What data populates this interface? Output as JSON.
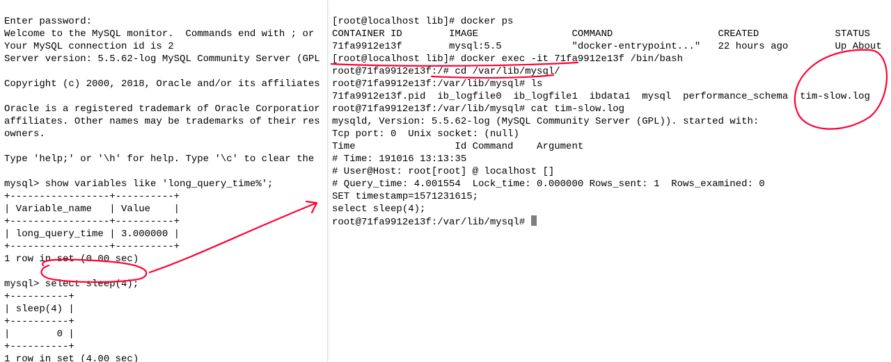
{
  "left": {
    "lines": [
      "Enter password:",
      "Welcome to the MySQL monitor.  Commands end with ; or ",
      "Your MySQL connection id is 2",
      "Server version: 5.5.62-log MySQL Community Server (GPL",
      "",
      "Copyright (c) 2000, 2018, Oracle and/or its affiliates",
      "",
      "Oracle is a registered trademark of Oracle Corporatior",
      "affiliates. Other names may be trademarks of their res",
      "owners.",
      "",
      "Type 'help;' or '\\h' for help. Type '\\c' to clear the ",
      "",
      "mysql> show variables like 'long_query_time%';",
      "+-----------------+----------+",
      "| Variable_name   | Value    |",
      "+-----------------+----------+",
      "| long_query_time | 3.000000 |",
      "+-----------------+----------+",
      "1 row in set (0.00 sec)",
      "",
      "mysql> select sleep(4);",
      "+----------+",
      "| sleep(4) |",
      "+----------+",
      "|        0 |",
      "+----------+",
      "1 row in set (4.00 sec)"
    ]
  },
  "right": {
    "docker_ps_cmd": "[root@localhost lib]# docker ps",
    "docker_ps_header": "CONTAINER ID        IMAGE                COMMAND                  CREATED             STATUS",
    "docker_ps_row": "71fa9912e13f        mysql:5.5            \"docker-entrypoint...\"   22 hours ago        Up About",
    "exec_cmd": "[root@localhost lib]# docker exec -it 71fa9912e13f /bin/bash",
    "cd_cmd": "root@71fa9912e13f:/# cd /var/lib/mysql/",
    "ls_cmd": "root@71fa9912e13f:/var/lib/mysql# ls",
    "ls_out": "71fa9912e13f.pid  ib_logfile0  ib_logfile1  ibdata1  mysql  performance_schema  tim-slow.log",
    "cat_cmd": "root@71fa9912e13f:/var/lib/mysql# cat tim-slow.log",
    "log1": "mysqld, Version: 5.5.62-log (MySQL Community Server (GPL)). started with:",
    "log2": "Tcp port: 0  Unix socket: (null)",
    "log3": "Time                 Id Command    Argument",
    "log4": "# Time: 191016 13:13:35",
    "log5": "# User@Host: root[root] @ localhost []",
    "log6": "# Query_time: 4.001554  Lock_time: 0.000000 Rows_sent: 1  Rows_examined: 0",
    "log7": "SET timestamp=1571231615;",
    "log8": "select sleep(4);",
    "prompt2": "root@71fa9912e13f:/var/lib/mysql# "
  },
  "chart_data": {
    "type": "table",
    "tables": [
      {
        "title": "show variables like 'long_query_time%'",
        "columns": [
          "Variable_name",
          "Value"
        ],
        "rows": [
          [
            "long_query_time",
            "3.000000"
          ]
        ],
        "footer": "1 row in set (0.00 sec)"
      },
      {
        "title": "select sleep(4)",
        "columns": [
          "sleep(4)"
        ],
        "rows": [
          [
            "0"
          ]
        ],
        "footer": "1 row in set (4.00 sec)"
      },
      {
        "title": "docker ps",
        "columns": [
          "CONTAINER ID",
          "IMAGE",
          "COMMAND",
          "CREATED",
          "STATUS"
        ],
        "rows": [
          [
            "71fa9912e13f",
            "mysql:5.5",
            "\"docker-entrypoint...\"",
            "22 hours ago",
            "Up About"
          ]
        ]
      }
    ],
    "slow_log": {
      "file": "tim-slow.log",
      "time": "191016 13:13:35",
      "user_host": "root[root] @ localhost []",
      "query_time": 4.001554,
      "lock_time": 0.0,
      "rows_sent": 1,
      "rows_examined": 0,
      "timestamp": 1571231615,
      "statement": "select sleep(4);"
    }
  },
  "annotations": {
    "circles": [
      "select sleep(4);",
      "tim-slow.log"
    ],
    "underlines": [
      "root@71fa9912e13f:/# cd /var/lib/mysql/",
      "root@71fa9912e13f:/var/lib/mysql# ls"
    ],
    "arrow": "from select sleep(4) to right pane"
  }
}
